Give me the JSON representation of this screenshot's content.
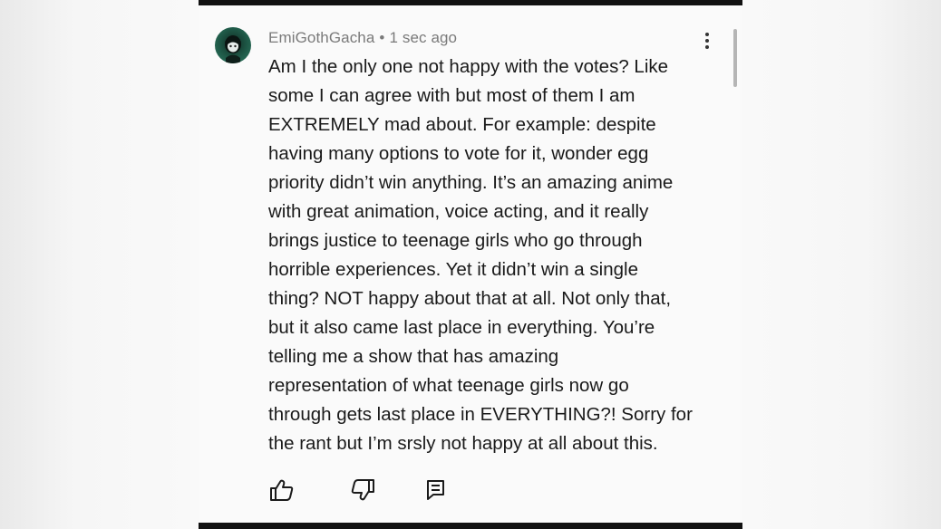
{
  "comment": {
    "author": "EmiGothGacha",
    "separator": "•",
    "timestamp": "1 sec ago",
    "body": "Am I the only one not happy with the votes? Like\nsome I can agree with but most of them I am\nEXTREMELY mad about. For example: despite\nhaving many options to vote for it, wonder egg\npriority didn’t win anything. It’s an amazing anime\nwith great animation, voice acting, and it really\nbrings justice to teenage girls who go through\nhorrible experiences. Yet it didn’t win a single\nthing? NOT happy about that at all. Not only that,\nbut it also came last place in everything. You’re\ntelling me a show that has amazing\nrepresentation of what teenage girls now go\nthrough gets last place in EVERYTHING?! Sorry for\nthe rant but I’m srsly not happy at all about this."
  },
  "icons": {
    "avatar": "avatar-image",
    "more": "more-vert-icon",
    "like": "thumbs-up-icon",
    "dislike": "thumbs-down-icon",
    "reply": "reply-comment-icon"
  },
  "colors": {
    "text": "#1a1a1a",
    "meta": "#7a7a7a",
    "background": "#fafafa",
    "frame": "#111111"
  }
}
